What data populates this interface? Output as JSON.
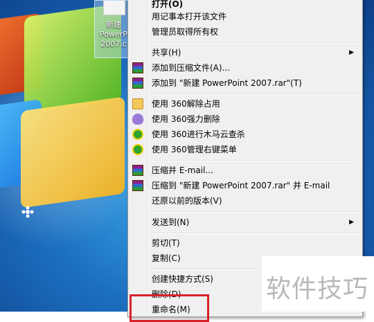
{
  "desktop": {
    "file_icon_label_lines": [
      "新建",
      "PowerP",
      "2007.c"
    ]
  },
  "context_menu": {
    "items": [
      {
        "label": "打开(O)",
        "icon": "",
        "submenu": false
      },
      {
        "label": "用记事本打开该文件",
        "icon": "",
        "submenu": false
      },
      {
        "label": "管理员取得所有权",
        "icon": "",
        "submenu": false
      },
      {
        "label": "共享(H)",
        "icon": "",
        "submenu": true
      },
      {
        "label": "添加到压缩文件(A)...",
        "icon": "winrar-icon",
        "submenu": false
      },
      {
        "label": "添加到 \"新建 PowerPoint 2007.rar\"(T)",
        "icon": "winrar-icon",
        "submenu": false
      },
      {
        "label": "使用 360解除占用",
        "icon": "folder-icon",
        "submenu": false
      },
      {
        "label": "使用 360强力删除",
        "icon": "shield-icon",
        "submenu": false
      },
      {
        "label": "使用 360进行木马云查杀",
        "icon": "360-icon",
        "submenu": false
      },
      {
        "label": "使用 360管理右键菜单",
        "icon": "360-icon",
        "submenu": false
      },
      {
        "label": "压缩并 E-mail...",
        "icon": "winrar-icon",
        "submenu": false
      },
      {
        "label": "压缩到 \"新建 PowerPoint 2007.rar\" 并 E-mail",
        "icon": "winrar-icon",
        "submenu": false
      },
      {
        "label": "还原以前的版本(V)",
        "icon": "",
        "submenu": false
      },
      {
        "label": "发送到(N)",
        "icon": "",
        "submenu": true
      },
      {
        "label": "剪切(T)",
        "icon": "",
        "submenu": false
      },
      {
        "label": "复制(C)",
        "icon": "",
        "submenu": false
      },
      {
        "label": "创建快捷方式(S)",
        "icon": "",
        "submenu": false
      },
      {
        "label": "删除(D)",
        "icon": "",
        "submenu": false
      },
      {
        "label": "重命名(M)",
        "icon": "",
        "submenu": false
      }
    ],
    "submenu_arrow": "▶"
  },
  "watermark": {
    "text": "软件技巧"
  }
}
